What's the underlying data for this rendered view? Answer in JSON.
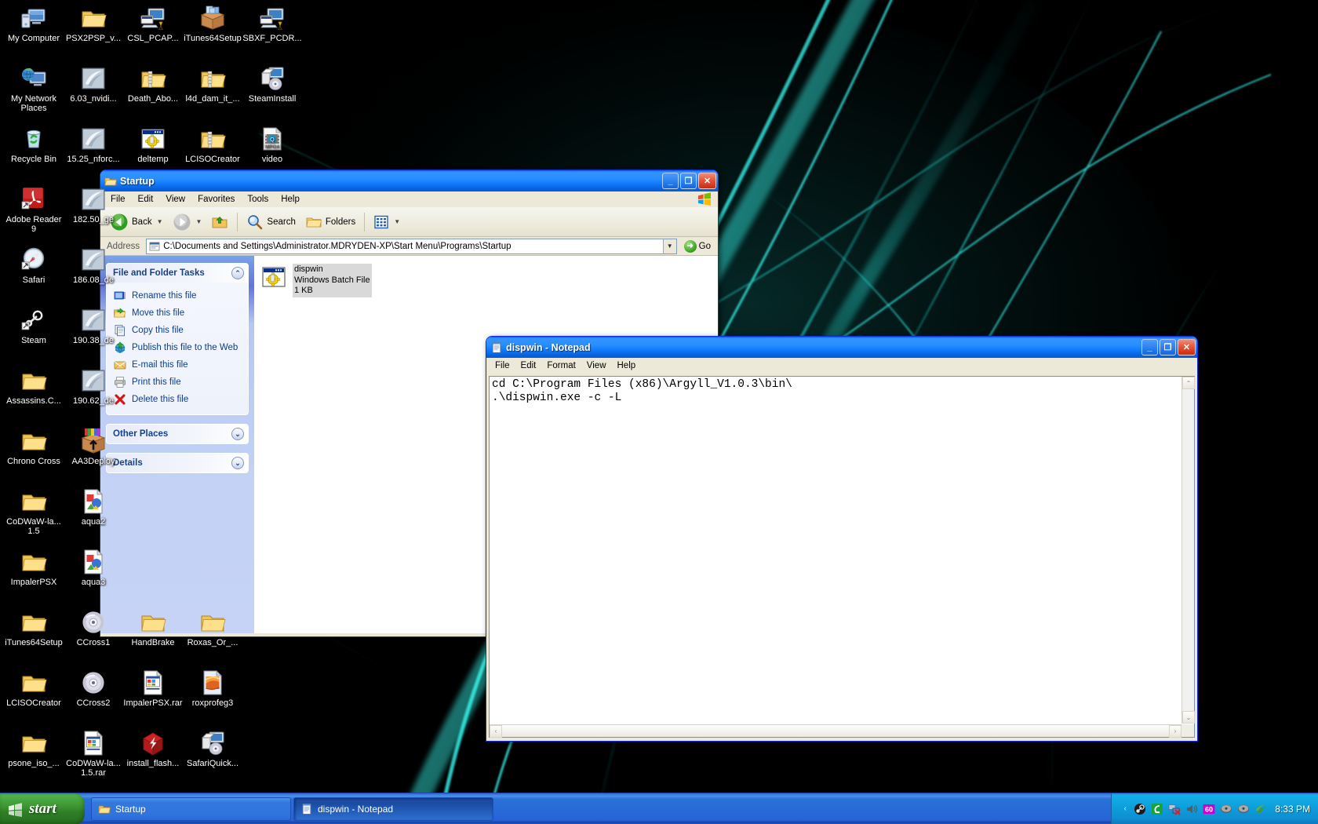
{
  "desktop": {
    "wallpaper_colors": {
      "background": "#000000",
      "accent": "#1fd8d0",
      "accent_dim": "#0b6f6b"
    },
    "icons": [
      {
        "label": "My Computer",
        "icon": "my-computer-icon",
        "col": 0,
        "row": 0
      },
      {
        "label": "PSX2PSP_v...",
        "icon": "folder-icon",
        "col": 1,
        "row": 0
      },
      {
        "label": "CSL_PCAP...",
        "icon": "installer-icon",
        "col": 2,
        "row": 0
      },
      {
        "label": "iTunes64Setup",
        "icon": "package-box-icon",
        "col": 3,
        "row": 0
      },
      {
        "label": "SBXF_PCDR...",
        "icon": "installer-icon",
        "col": 4,
        "row": 0
      },
      {
        "label": "My Network Places",
        "icon": "network-places-icon",
        "col": 0,
        "row": 1
      },
      {
        "label": "6.03_nvidi...",
        "icon": "nvidia-icon",
        "col": 1,
        "row": 1
      },
      {
        "label": "Death_Abo...",
        "icon": "zip-folder-icon",
        "col": 2,
        "row": 1
      },
      {
        "label": "l4d_dam_it_...",
        "icon": "zip-folder-icon",
        "col": 3,
        "row": 1
      },
      {
        "label": "SteamInstall",
        "icon": "setup-cd-icon",
        "col": 4,
        "row": 1
      },
      {
        "label": "Recycle Bin",
        "icon": "recycle-bin-icon",
        "col": 0,
        "row": 2
      },
      {
        "label": "15.25_nforc...",
        "icon": "nvidia-icon",
        "col": 1,
        "row": 2
      },
      {
        "label": "deltemp",
        "icon": "batch-file-icon",
        "col": 2,
        "row": 2
      },
      {
        "label": "LCISOCreator",
        "icon": "zip-folder-icon",
        "col": 3,
        "row": 2
      },
      {
        "label": "video",
        "icon": "mpg4-file-icon",
        "col": 4,
        "row": 2
      },
      {
        "label": "Adobe Reader 9",
        "icon": "adobe-reader-icon",
        "col": 0,
        "row": 3
      },
      {
        "label": "182.50_ge",
        "icon": "nvidia-icon",
        "col": 1,
        "row": 3
      },
      {
        "label": "Safari",
        "icon": "safari-icon",
        "col": 0,
        "row": 4
      },
      {
        "label": "186.08_de",
        "icon": "nvidia-icon",
        "col": 1,
        "row": 4
      },
      {
        "label": "Steam",
        "icon": "steam-icon",
        "col": 0,
        "row": 5
      },
      {
        "label": "190.38_de",
        "icon": "nvidia-icon",
        "col": 1,
        "row": 5
      },
      {
        "label": "Assassins.C...",
        "icon": "folder-icon",
        "col": 0,
        "row": 6
      },
      {
        "label": "190.62_de",
        "icon": "nvidia-icon",
        "col": 1,
        "row": 6
      },
      {
        "label": "Chrono Cross",
        "icon": "folder-icon",
        "col": 0,
        "row": 7
      },
      {
        "label": "AA3Deploy",
        "icon": "deploy-box-icon",
        "col": 1,
        "row": 7
      },
      {
        "label": "CoDWaW-la... 1.5",
        "icon": "folder-icon",
        "col": 0,
        "row": 8
      },
      {
        "label": "aqua2",
        "icon": "image-file-icon",
        "col": 1,
        "row": 8
      },
      {
        "label": "ImpalerPSX",
        "icon": "folder-icon",
        "col": 0,
        "row": 9
      },
      {
        "label": "aqua3",
        "icon": "image-file-icon",
        "col": 1,
        "row": 9
      },
      {
        "label": "iTunes64Setup",
        "icon": "folder-icon",
        "col": 0,
        "row": 10
      },
      {
        "label": "CCross1",
        "icon": "disc-icon",
        "col": 1,
        "row": 10
      },
      {
        "label": "HandBrake",
        "icon": "folder-icon",
        "col": 2,
        "row": 10
      },
      {
        "label": "Roxas_Or_...",
        "icon": "folder-icon",
        "col": 3,
        "row": 10
      },
      {
        "label": "LCISOCreator",
        "icon": "folder-icon",
        "col": 0,
        "row": 11
      },
      {
        "label": "CCross2",
        "icon": "disc-icon",
        "col": 1,
        "row": 11
      },
      {
        "label": "ImpalerPSX.rar",
        "icon": "rar-file-icon",
        "col": 2,
        "row": 11
      },
      {
        "label": "roxprofeg3",
        "icon": "roxio-file-icon",
        "col": 3,
        "row": 11
      },
      {
        "label": "psone_iso_...",
        "icon": "folder-icon",
        "col": 0,
        "row": 12
      },
      {
        "label": "CoDWaW-la... 1.5.rar",
        "icon": "rar-file-icon",
        "col": 1,
        "row": 12
      },
      {
        "label": "install_flash...",
        "icon": "flash-installer-icon",
        "col": 2,
        "row": 12
      },
      {
        "label": "SafariQuick...",
        "icon": "setup-cd-icon",
        "col": 3,
        "row": 12
      }
    ]
  },
  "explorer": {
    "title": "Startup",
    "title_icon": "open-folder-icon",
    "window_buttons": {
      "minimize": "_",
      "maximize": "❐",
      "close": "✕"
    },
    "menu": [
      "File",
      "Edit",
      "View",
      "Favorites",
      "Tools",
      "Help"
    ],
    "toolbar": {
      "back_label": "Back",
      "forward_label": "",
      "up_label": "",
      "search_label": "Search",
      "folders_label": "Folders",
      "views_label": ""
    },
    "address": {
      "label": "Address",
      "value": "C:\\Documents and Settings\\Administrator.MDRYDEN-XP\\Start Menu\\Programs\\Startup",
      "go_label": "Go"
    },
    "panels": [
      {
        "title": "File and Folder Tasks",
        "state": "expanded",
        "chevron": "⌃",
        "tasks": [
          {
            "label": "Rename this file",
            "icon": "rename-icon"
          },
          {
            "label": "Move this file",
            "icon": "move-icon"
          },
          {
            "label": "Copy this file",
            "icon": "copy-icon"
          },
          {
            "label": "Publish this file to the Web",
            "icon": "publish-web-icon"
          },
          {
            "label": "E-mail this file",
            "icon": "email-icon"
          },
          {
            "label": "Print this file",
            "icon": "print-icon"
          },
          {
            "label": "Delete this file",
            "icon": "delete-x-icon"
          }
        ]
      },
      {
        "title": "Other Places",
        "state": "collapsed",
        "chevron": "⌄",
        "tasks": []
      },
      {
        "title": "Details",
        "state": "collapsed",
        "chevron": "⌄",
        "tasks": []
      }
    ],
    "files": [
      {
        "name": "dispwin",
        "type": "Windows Batch File",
        "size": "1 KB",
        "icon": "batch-file-icon",
        "selected": true
      }
    ]
  },
  "notepad": {
    "title": "dispwin - Notepad",
    "title_icon": "notepad-icon",
    "window_buttons": {
      "minimize": "_",
      "maximize": "❐",
      "close": "✕"
    },
    "menu": [
      "File",
      "Edit",
      "Format",
      "View",
      "Help"
    ],
    "content": "cd C:\\Program Files (x86)\\Argyll_V1.0.3\\bin\\\n.\\dispwin.exe -c -L",
    "scrollbars": {
      "up": "⌃",
      "down": "⌄",
      "left": "‹",
      "right": "›"
    }
  },
  "taskbar": {
    "start_label": "start",
    "start_icon": "windows-flag-icon",
    "buttons": [
      {
        "label": "Startup",
        "icon": "folder-icon",
        "active": false
      },
      {
        "label": "dispwin - Notepad",
        "icon": "notepad-icon",
        "active": true
      }
    ],
    "tray": {
      "icons": [
        "steam-tray-icon",
        "eset-tray-icon",
        "network-disconnected-icon",
        "volume-icon",
        "daemon-tools-icon",
        "drive-tray-icon",
        "drive-tray-icon-2",
        "nvidia-tray-icon"
      ],
      "clock": "8:33 PM"
    }
  }
}
